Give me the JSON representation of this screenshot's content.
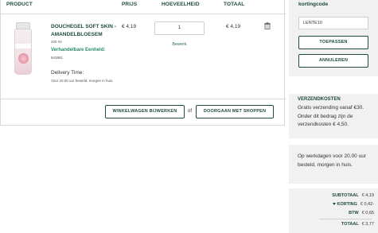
{
  "table": {
    "headers": {
      "product": "PRODUCT",
      "price": "PRIJS",
      "quantity": "HOEVEELHEID",
      "total": "TOTAAL"
    }
  },
  "item": {
    "name": "DOUCHEGEL SOFT SKIN - AMANDELBLOESEM",
    "size": "200 ml",
    "unit_label": "Verhandelbare Eenheid:",
    "code": "943881",
    "delivery_title": "Delivery Time:",
    "delivery_text": "Voor 20.00 uur besteld, morgen in huis.",
    "price": "€ 4,19",
    "quantity": "1",
    "edit_label": "Bewerk",
    "total": "€ 4,19",
    "image_icon": "product-bottle-icon",
    "delete_icon": "trash-icon"
  },
  "actions": {
    "update_cart": "WINKELWAGEN BIJWERKEN",
    "or": "of",
    "continue_shopping": "DOORGAAN MET SHOPPEN"
  },
  "coupon": {
    "title": "kortingcode",
    "value": "LENTE10",
    "apply": "TOEPASSEN",
    "cancel": "ANNULEREN"
  },
  "shipping": {
    "title": "VERZENDKOSTEN",
    "text": "Gratis verzending vanaf €30. Onder dit bedrag zijn de verzendkosten € 4,50."
  },
  "delivery_note": "Op werkdagen voor 20.00 uur besteld, morgen in huis.",
  "summary": {
    "subtotal_label": "SUBTOTAAL",
    "subtotal": "€ 4,19",
    "discount_label": "KORTING",
    "discount": "€ 0,42-",
    "vat_label": "BTW",
    "vat": "€ 0,65",
    "total_label": "TOTAAL",
    "total": "€ 3,77"
  },
  "colors": {
    "accent": "#1d4a3c",
    "sidebar_bg": "#f1f1f1",
    "border": "#d9d9d9"
  }
}
